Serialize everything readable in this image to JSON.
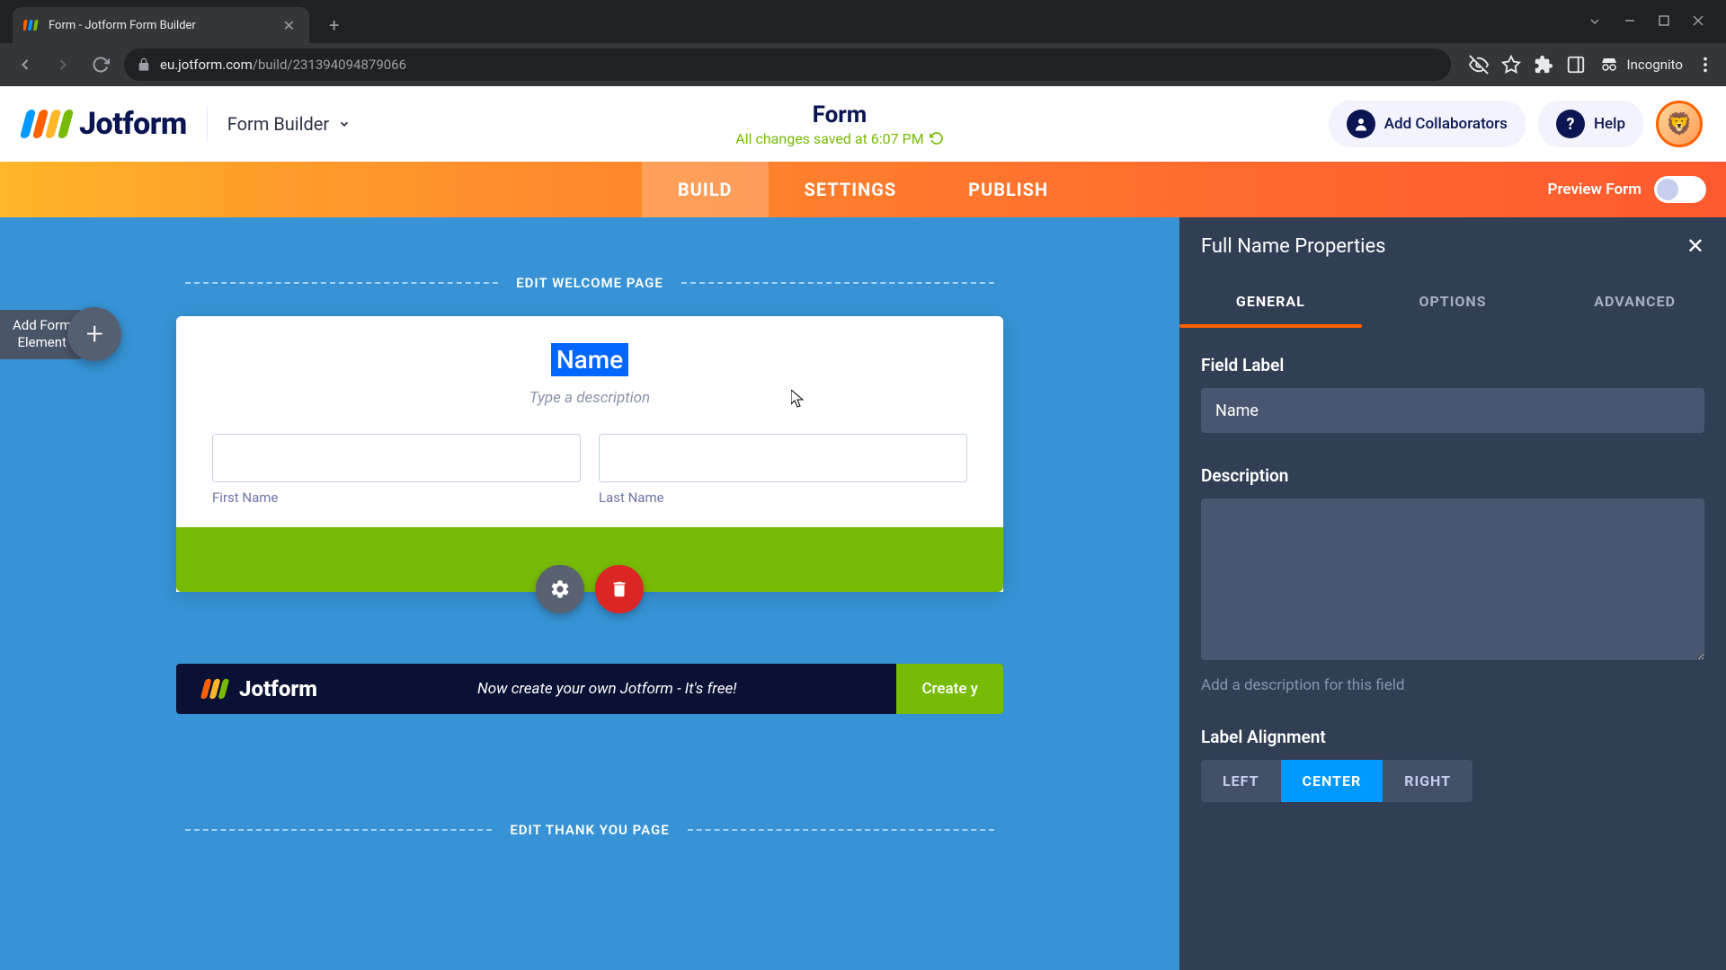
{
  "browser": {
    "tab_title": "Form - Jotform Form Builder",
    "url_host": "eu.jotform.com",
    "url_path": "/build/231394094879066",
    "incognito_label": "Incognito"
  },
  "header": {
    "logo_text": "Jotform",
    "form_builder_label": "Form Builder",
    "form_title": "Form",
    "save_status": "All changes saved at 6:07 PM",
    "add_collab_label": "Add Collaborators",
    "help_label": "Help"
  },
  "nav": {
    "tabs": [
      "BUILD",
      "SETTINGS",
      "PUBLISH"
    ],
    "preview_label": "Preview Form"
  },
  "canvas": {
    "add_element_line1": "Add Form",
    "add_element_line2": "Element",
    "welcome_divider": "EDIT WELCOME PAGE",
    "thankyou_divider": "EDIT THANK YOU PAGE",
    "card_title": "Name",
    "card_desc_placeholder": "Type a description",
    "first_name_label": "First Name",
    "last_name_label": "Last Name"
  },
  "promo": {
    "logo_text": "Jotform",
    "text": "Now create your own Jotform - It's free!",
    "btn": "Create y"
  },
  "props": {
    "title": "Full Name Properties",
    "tabs": [
      "GENERAL",
      "OPTIONS",
      "ADVANCED"
    ],
    "field_label_title": "Field Label",
    "field_label_value": "Name",
    "description_title": "Description",
    "description_hint": "Add a description for this field",
    "alignment_title": "Label Alignment",
    "alignment_options": [
      "LEFT",
      "CENTER",
      "RIGHT"
    ]
  }
}
